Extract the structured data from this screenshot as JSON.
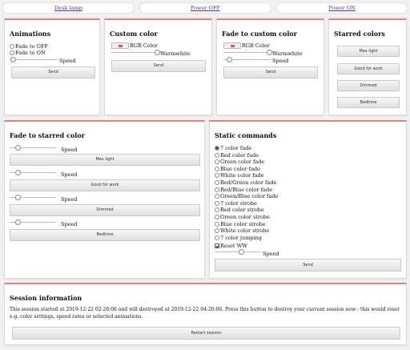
{
  "top_nav": {
    "desk_lamp": "Desk lamp",
    "power_off": "Power OFF",
    "power_on": "Power ON"
  },
  "animations": {
    "title": "Animations",
    "options": [
      "Fade to OFF",
      "Fade to ON"
    ],
    "speed_label": "Speed",
    "send_label": "Send"
  },
  "custom_color": {
    "title": "Custom color",
    "rgb_label": "RGB Color",
    "warmwhite_label": "Warmwhite",
    "send_label": "Send"
  },
  "fade_custom": {
    "title": "Fade to custom color",
    "rgb_label": "RGB Color",
    "warmwhite_label": "Warmwhite",
    "speed_label": "Speed",
    "send_label": "Send"
  },
  "starred_colors": {
    "title": "Starred colors",
    "buttons": [
      "Max light",
      "Good for work",
      "Dimmed",
      "Bedtime"
    ]
  },
  "fade_starred": {
    "title": "Fade to starred color",
    "speed_label": "Speed",
    "buttons": [
      "Max light",
      "Good for work",
      "Dimmed",
      "Bedtime"
    ]
  },
  "static_commands": {
    "title": "Static commands",
    "options": [
      "7 color fade",
      "Red color fade",
      "Green color fade",
      "Blue color fade",
      "White color fade",
      "Red/Green color fade",
      "Red/Blue color fade",
      "Green/Blue color fade",
      "7 color strobe",
      "Red color strobe",
      "Green color strobe",
      "Blue color strobe",
      "White color strobe",
      "7 color jumping"
    ],
    "selected_index": 0,
    "reset_label": "Reset WW",
    "reset_checked": true,
    "speed_label": "Speed",
    "send_label": "Send"
  },
  "session": {
    "title": "Session information",
    "text": "This session started at 2019-12-22 02:20:06 and will destroyed at 2019-12-22 04:20:06. Press this button to destroy your current session now - this would reset e.g. color settings, speed rates or selected animations.",
    "restart_label": "Restart session"
  },
  "colors": {
    "accent": "#f07c7c",
    "link": "#5a2ea6",
    "swatch_red": "#e05555"
  }
}
